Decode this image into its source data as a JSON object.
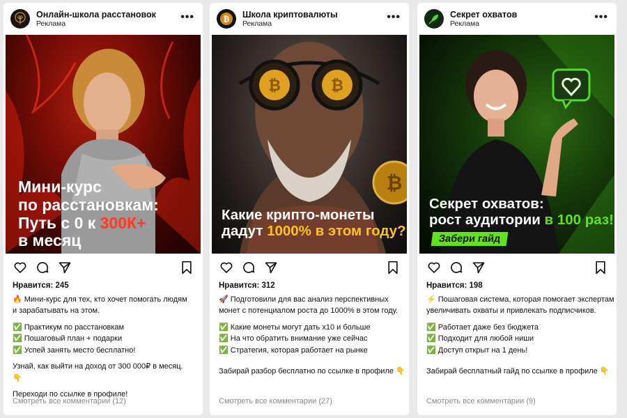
{
  "posts": [
    {
      "account": "Онлайн-школа расстановок",
      "sponsored": "Реклама",
      "avatar_icon": "tree-icon",
      "image_text": {
        "l1": "Мини-курс",
        "l2": "по расстановкам:",
        "l3a": "Путь с 0 к ",
        "l3b": "300К+",
        "l4": "в месяц"
      },
      "likes": "Нравится: 245",
      "caption": {
        "intro1": "🔥 Мини-курс для тех, кто хочет помогать людям",
        "intro2": "и зарабатывать на этом.",
        "bullets": [
          "✅ Практикум по расстановкам",
          "✅ Пошаговый план + подарки",
          "✅ Успей занять место бесплатно!"
        ],
        "cta1": "Узнай, как выйти на доход от 300 000₽ в месяц.",
        "cta2": "👇",
        "cta3": "Переходи по ссылке в профиле!"
      },
      "comments": "Смотреть все комментарии (12)"
    },
    {
      "account": "Школа криптовалюты",
      "sponsored": "Реклама",
      "avatar_icon": "bitcoin-coin-icon",
      "image_text": {
        "l1": "Какие крипто-монеты",
        "l2a": "дадут ",
        "l2b": "1000% в этом году?"
      },
      "likes": "Нравится: 312",
      "caption": {
        "intro1": "🚀 Подготовили для вас анализ перспективных",
        "intro2": "монет с потенциалом роста до 1000% в этом году.",
        "bullets": [
          "✅ Какие монеты могут дать x10 и больше",
          "✅ На что обратить внимание уже сейчас",
          "✅ Стратегия, которая работает на рынке"
        ],
        "cta1": "Забирай разбор бесплатно по ссылке в профиле 👇"
      },
      "comments": "Смотреть все комментарии (27)"
    },
    {
      "account": "Секрет охватов",
      "sponsored": "Реклама",
      "avatar_icon": "rocket-icon",
      "image_text": {
        "l1": "Секрет охватов:",
        "l2a": "рост аудитории ",
        "l2b": "в 100 раз!",
        "badge": "Забери гайд"
      },
      "likes": "Нравится: 198",
      "caption": {
        "intro1": "⚡ Пошаговая система, которая помогает экспертам",
        "intro2": "увеличивать охваты и привлекать подписчиков.",
        "bullets": [
          "✅ Работает даже без бюджета",
          "✅ Подходит для любой ниши",
          "✅ Доступ открыт на 1 день!"
        ],
        "cta1": "Забирай бесплатный гайд по ссылке в профиле 👇"
      },
      "comments": "Смотреть все комментарии (9)"
    }
  ],
  "colors": {
    "accent_red": "#ff3a1f",
    "accent_yellow": "#ffc11c",
    "accent_green": "#5ee31c"
  }
}
